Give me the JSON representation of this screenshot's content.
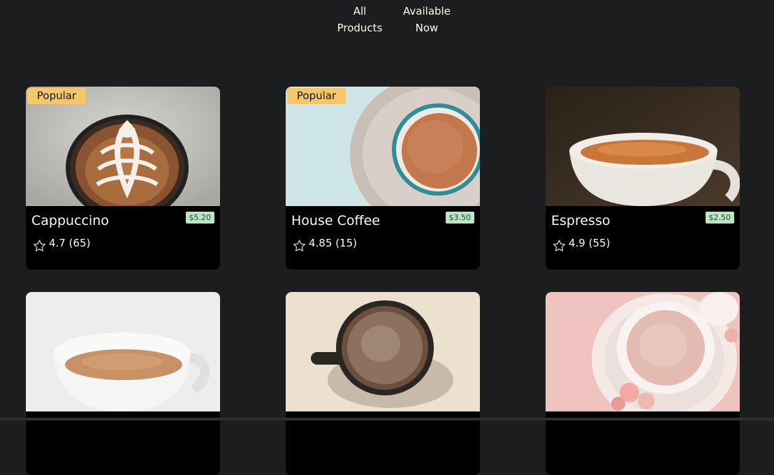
{
  "filters": {
    "all": [
      "All",
      "Products"
    ],
    "available": [
      "Available",
      "Now"
    ]
  },
  "products": [
    {
      "name": "Cappuccino",
      "price": "$5.20",
      "rating": "4.7",
      "votes": "(65)",
      "badge": "Popular"
    },
    {
      "name": "House Coffee",
      "price": "$3.50",
      "rating": "4.85",
      "votes": "(15)",
      "badge": "Popular"
    },
    {
      "name": "Espresso",
      "price": "$2.50",
      "rating": "4.9",
      "votes": "(55)",
      "badge": ""
    },
    {
      "name": "",
      "price": "",
      "rating": "",
      "votes": "",
      "badge": ""
    },
    {
      "name": "",
      "price": "",
      "rating": "",
      "votes": "",
      "badge": ""
    },
    {
      "name": "",
      "price": "",
      "rating": "",
      "votes": "",
      "badge": ""
    }
  ],
  "colors": {
    "background": "#1b1d1f",
    "card": "#000000",
    "badge": "#f6c768",
    "price_badge": "#bee3c6",
    "text": "#fefce8"
  },
  "icons": {
    "rating_star": "star-outline-icon"
  }
}
